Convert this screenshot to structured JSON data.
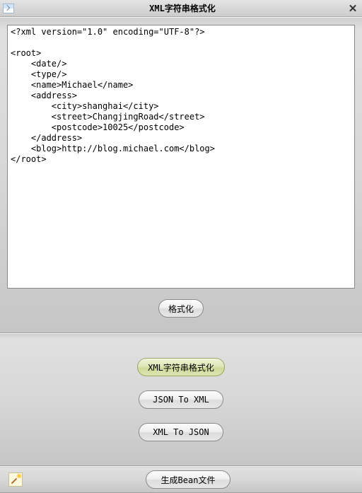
{
  "titlebar": {
    "title": "XML字符串格式化",
    "close_label": "✕"
  },
  "editor": {
    "content": "<?xml version=\"1.0\" encoding=\"UTF-8\"?>\n\n<root>\n    <date/>\n    <type/>\n    <name>Michael</name>\n    <address>\n        <city>shanghai</city>\n        <street>ChangjingRoad</street>\n        <postcode>10025</postcode>\n    </address>\n    <blog>http://blog.michael.com</blog>\n</root>"
  },
  "buttons": {
    "format": "格式化",
    "xml_format": "XML字符串格式化",
    "json_to_xml": "JSON To XML",
    "xml_to_json": "XML To JSON",
    "gen_bean": "生成Bean文件"
  }
}
